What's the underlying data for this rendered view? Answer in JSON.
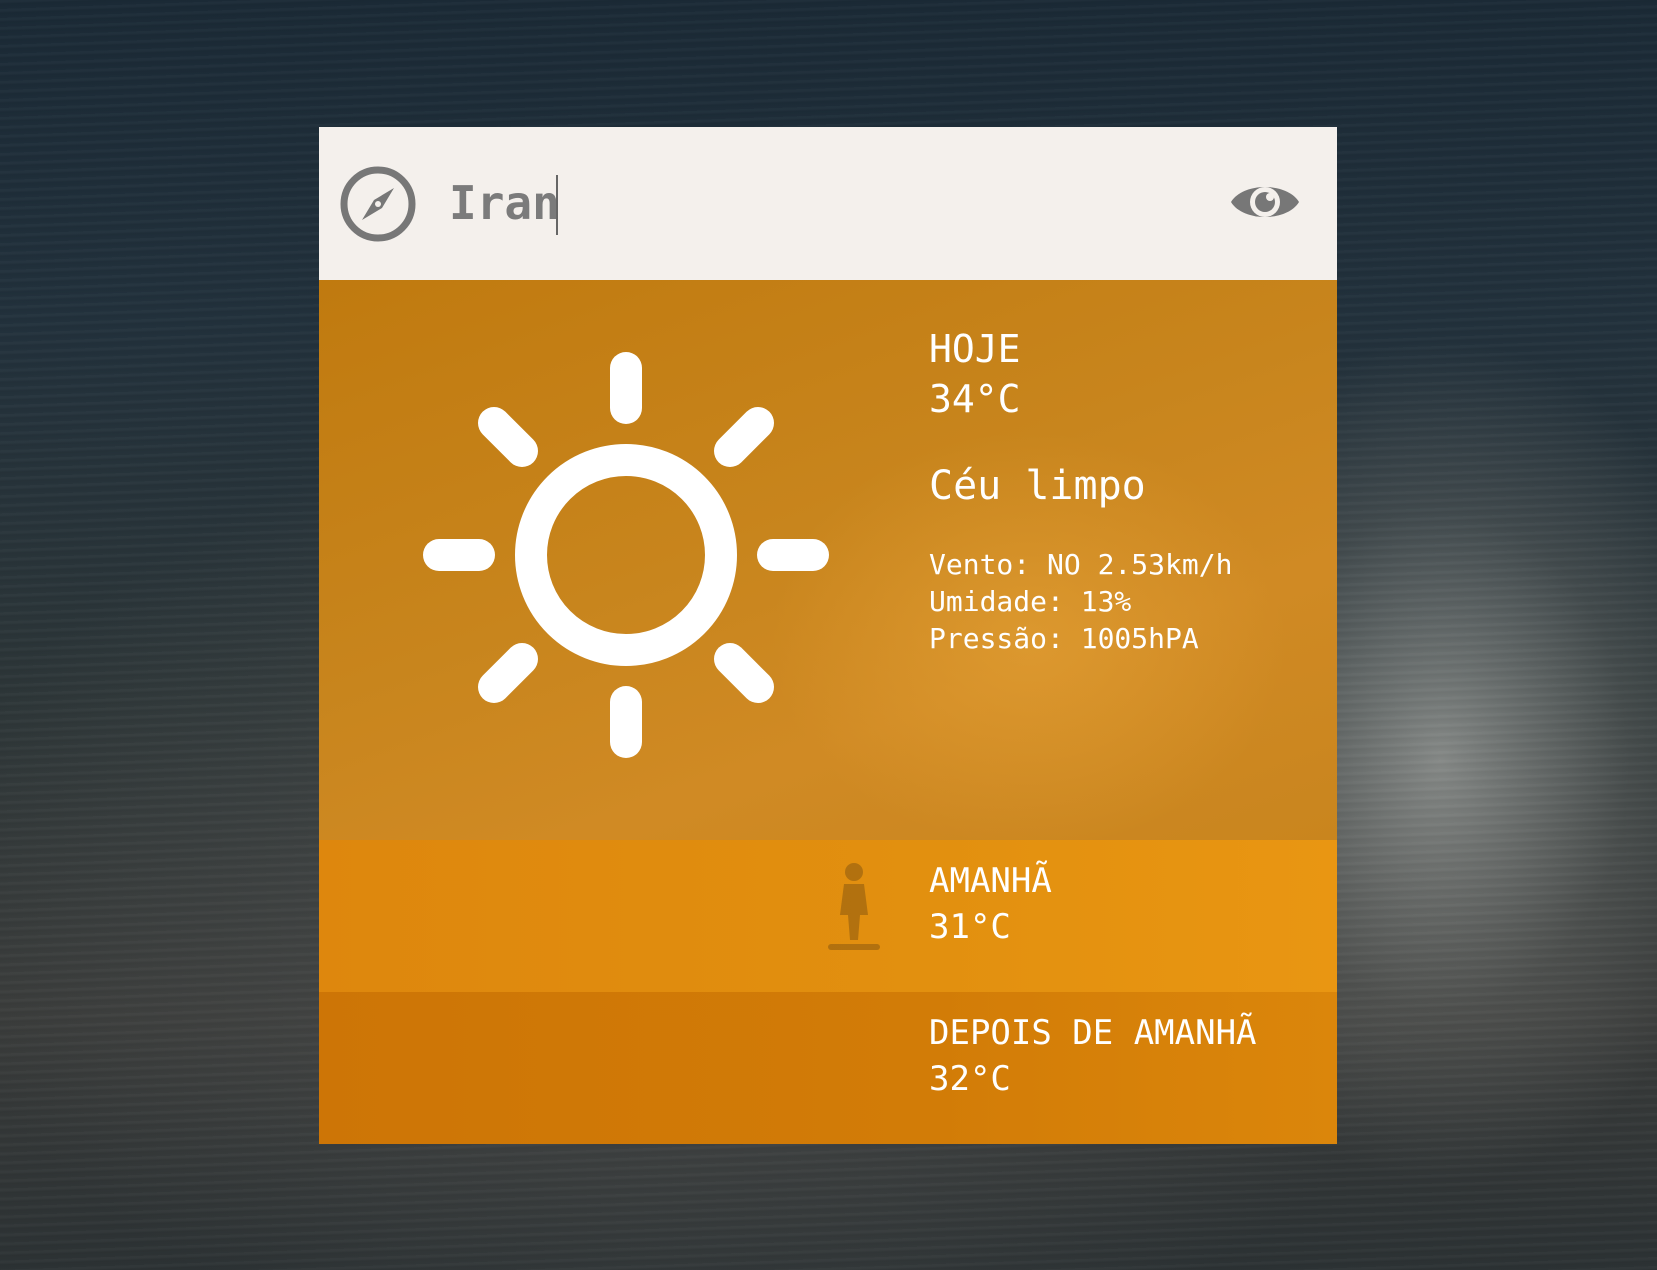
{
  "search": {
    "value": "Iran",
    "icon_left": "compass-icon",
    "icon_right": "eye-icon"
  },
  "today": {
    "icon": "sun-icon",
    "label": "HOJE",
    "temperature": "34°C",
    "description": "Céu limpo",
    "wind": "Vento: NO 2.53km/h",
    "humidity": "Umidade: 13%",
    "pressure": "Pressão: 1005hPA"
  },
  "tomorrow": {
    "label": "AMANHÃ",
    "temperature": "31°C"
  },
  "after_tomorrow": {
    "label": "DEPOIS DE AMANHÃ",
    "temperature": "32°C"
  },
  "colors": {
    "today_bg": "#c8851d",
    "tomorrow_bg": "#e2900f",
    "after_bg": "#d27c07",
    "search_bg": "#f4f0ec",
    "icon_gray": "#777777"
  }
}
